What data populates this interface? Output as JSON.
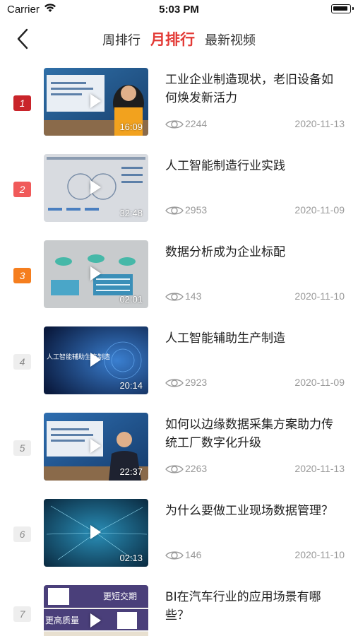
{
  "status_bar": {
    "carrier": "Carrier",
    "time": "5:03 PM"
  },
  "nav": {
    "tabs": [
      {
        "label": "周排行",
        "active": false
      },
      {
        "label": "月排行",
        "active": true
      },
      {
        "label": "最新视频",
        "active": false
      }
    ]
  },
  "items": [
    {
      "rank": "1",
      "title": "工业企业制造现状，老旧设备如何焕发新活力",
      "duration": "16:09",
      "views": "2244",
      "date": "2020-11-13"
    },
    {
      "rank": "2",
      "title": "人工智能制造行业实践",
      "duration": "32:48",
      "views": "2953",
      "date": "2020-11-09"
    },
    {
      "rank": "3",
      "title": "数据分析成为企业标配",
      "duration": "02:01",
      "views": "143",
      "date": "2020-11-10"
    },
    {
      "rank": "4",
      "title": "人工智能辅助生产制造",
      "duration": "20:14",
      "views": "2923",
      "date": "2020-11-09"
    },
    {
      "rank": "5",
      "title": "如何以边缘数据采集方案助力传统工厂数字化升级",
      "duration": "22:37",
      "views": "2263",
      "date": "2020-11-13"
    },
    {
      "rank": "6",
      "title": "为什么要做工业现场数据管理？",
      "duration": "02:13",
      "views": "146",
      "date": "2020-11-10"
    },
    {
      "rank": "7",
      "title": "BI在汽车行业的应用场景有哪些？",
      "duration": "",
      "views": "",
      "date": ""
    }
  ],
  "thumbnail_texts": {
    "t4": "人工智能辅助生产制造",
    "t7a": "更短交期",
    "t7b": "更高质量"
  },
  "colors": {
    "accent": "#e33a36",
    "rank1": "#c9242a",
    "rank2": "#f05a5a",
    "rank3": "#f57e1e"
  },
  "icons": {
    "back": "chevron-left-icon",
    "views": "eye-icon",
    "play": "play-icon"
  }
}
